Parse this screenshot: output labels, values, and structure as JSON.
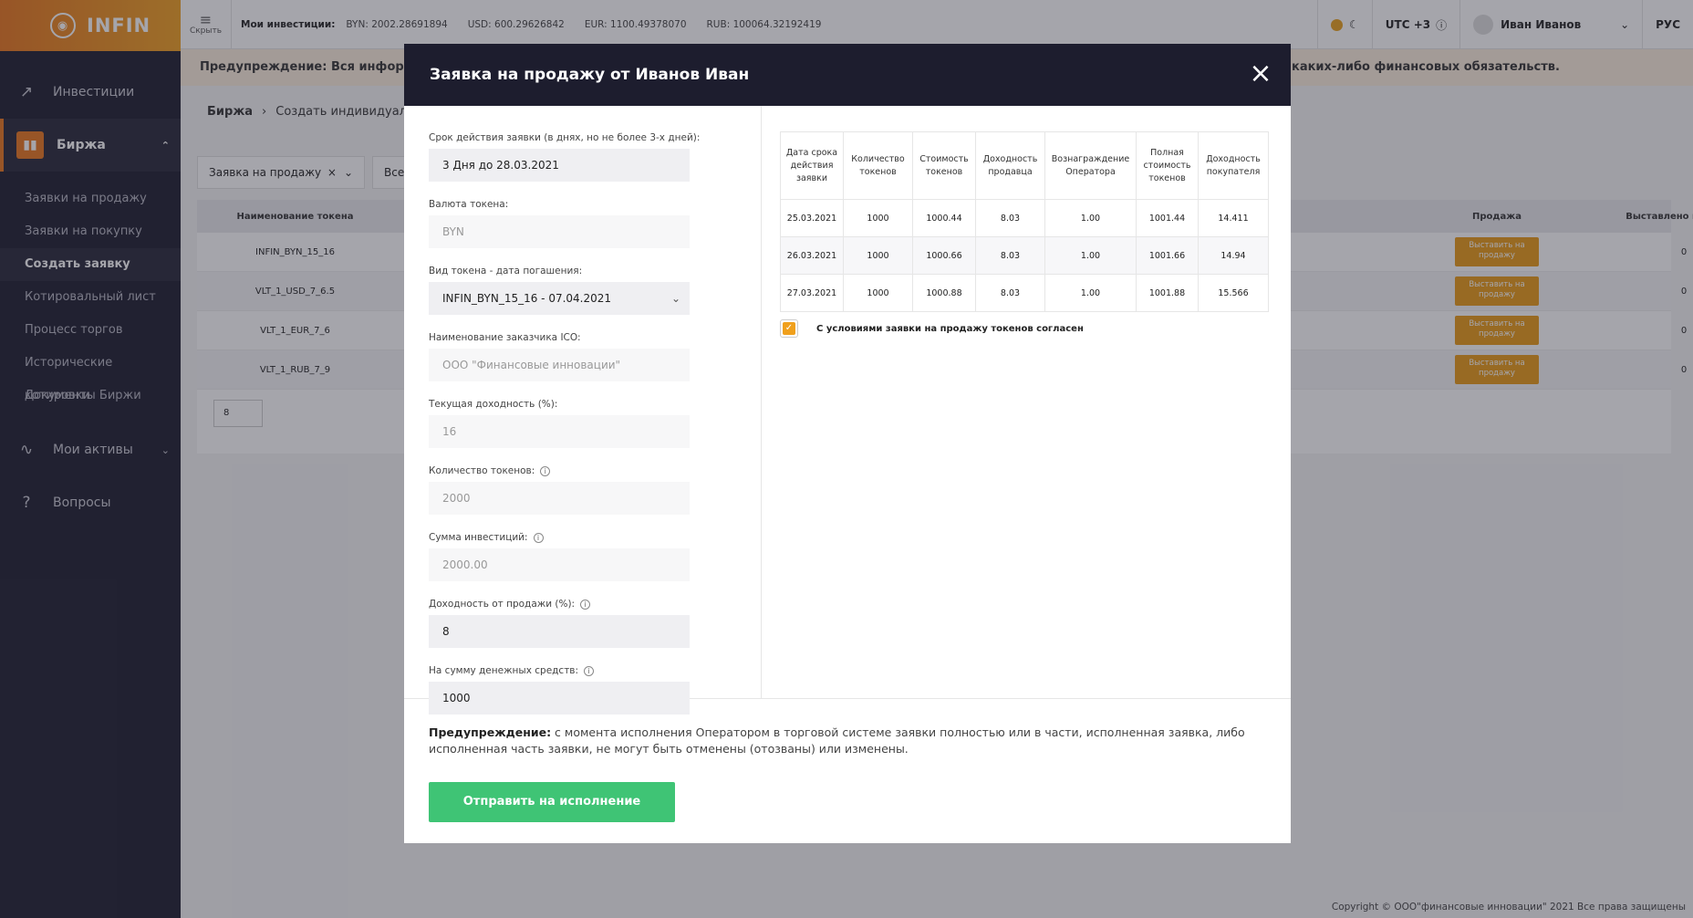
{
  "logo": {
    "text": "INFIN"
  },
  "sidebar": {
    "items": [
      {
        "label": "Инвестиции"
      },
      {
        "label": "Биржа"
      },
      {
        "label": "Мои активы"
      },
      {
        "label": "Вопросы"
      }
    ],
    "sub_items": [
      {
        "label": "Заявки на продажу"
      },
      {
        "label": "Заявки на покупку"
      },
      {
        "label": "Создать заявку"
      },
      {
        "label": "Котировальный лист"
      },
      {
        "label": "Процесс торгов"
      },
      {
        "label": "Исторические котировки"
      },
      {
        "label": "Документы Биржи"
      }
    ]
  },
  "topbar": {
    "hide_label": "Скрыть",
    "investments_label": "Мои инвестиции:",
    "balances": [
      {
        "text": "BYN: 2002.28691894"
      },
      {
        "text": "USD: 600.29626842"
      },
      {
        "text": "EUR: 1100.49378070"
      },
      {
        "text": "RUB: 100064.32192419"
      }
    ],
    "timezone": "UTC +3",
    "user": "Иван Иванов",
    "language": "РУС"
  },
  "background": {
    "warning_start": "Предупреждение: Вся информация",
    "warning_end": "каких-либо финансовых обязательств.",
    "breadcrumb": [
      "Биржа",
      "Создать индивидуальн"
    ],
    "filter_type": "Заявка на продажу",
    "filter_all": "Все",
    "columns": {
      "token": "Наименование токена",
      "sale": "Продажа",
      "exchange": "Выставлено на биржу"
    },
    "sale_button": "Выставить на продажу",
    "rows": [
      {
        "token": "INFIN_BYN_15_16",
        "exchange": "0"
      },
      {
        "token": "VLT_1_USD_7_6.5",
        "exchange": "0"
      },
      {
        "token": "VLT_1_EUR_7_6",
        "exchange": "0"
      },
      {
        "token": "VLT_1_RUB_7_9",
        "exchange": "0"
      }
    ],
    "page_size": "8"
  },
  "modal": {
    "title": "Заявка на продажу от Иванов Иван",
    "fields": [
      {
        "label": "Срок действия заявки (в днях, но не более 3-х дней):",
        "value": "3 Дня до 28.03.2021"
      },
      {
        "label": "Валюта токена:",
        "value": "BYN"
      },
      {
        "label": "Вид токена - дата погашения:",
        "value": "INFIN_BYN_15_16 - 07.04.2021"
      },
      {
        "label": "Наименование заказчика ICO:",
        "value": "ООО \"Финансовые инновации\""
      },
      {
        "label": "Текущая доходность (%):",
        "value": "16"
      },
      {
        "label": "Количество токенов:",
        "value": "2000"
      },
      {
        "label": "Сумма инвестиций:",
        "value": "2000.00"
      },
      {
        "label": "Доходность от продажи (%):",
        "value": "8"
      },
      {
        "label": "На сумму денежных средств:",
        "value": "1000"
      }
    ],
    "table": {
      "headers": [
        "Дата срока действия заявки",
        "Количество токенов",
        "Стоимость токенов",
        "Доходность продавца",
        "Вознаграждение Оператора",
        "Полная стоимость токенов",
        "Доходность покупателя"
      ],
      "rows": [
        [
          "25.03.2021",
          "1000",
          "1000.44",
          "8.03",
          "1.00",
          "1001.44",
          "14.411"
        ],
        [
          "26.03.2021",
          "1000",
          "1000.66",
          "8.03",
          "1.00",
          "1001.66",
          "14.94"
        ],
        [
          "27.03.2021",
          "1000",
          "1000.88",
          "8.03",
          "1.00",
          "1001.88",
          "15.566"
        ]
      ]
    },
    "agree_label": "С условиями заявки на продажу токенов согласен",
    "warning_bold": "Предупреждение:",
    "warning_text": " с момента исполнения Оператором в торговой системе заявки полностью или в части, исполненная заявка, либо исполненная часть заявки, не могут быть отменены (отозваны) или изменены.",
    "submit_label": "Отправить на исполнение"
  },
  "footer": {
    "text": "Copyright © ООО\"финансовые инновации\" 2021 Все права защищены"
  },
  "colors": {
    "accent": "#e8761c",
    "dark": "#1d1d2e",
    "success": "#3fc475",
    "sale_button": "#e89a16"
  }
}
